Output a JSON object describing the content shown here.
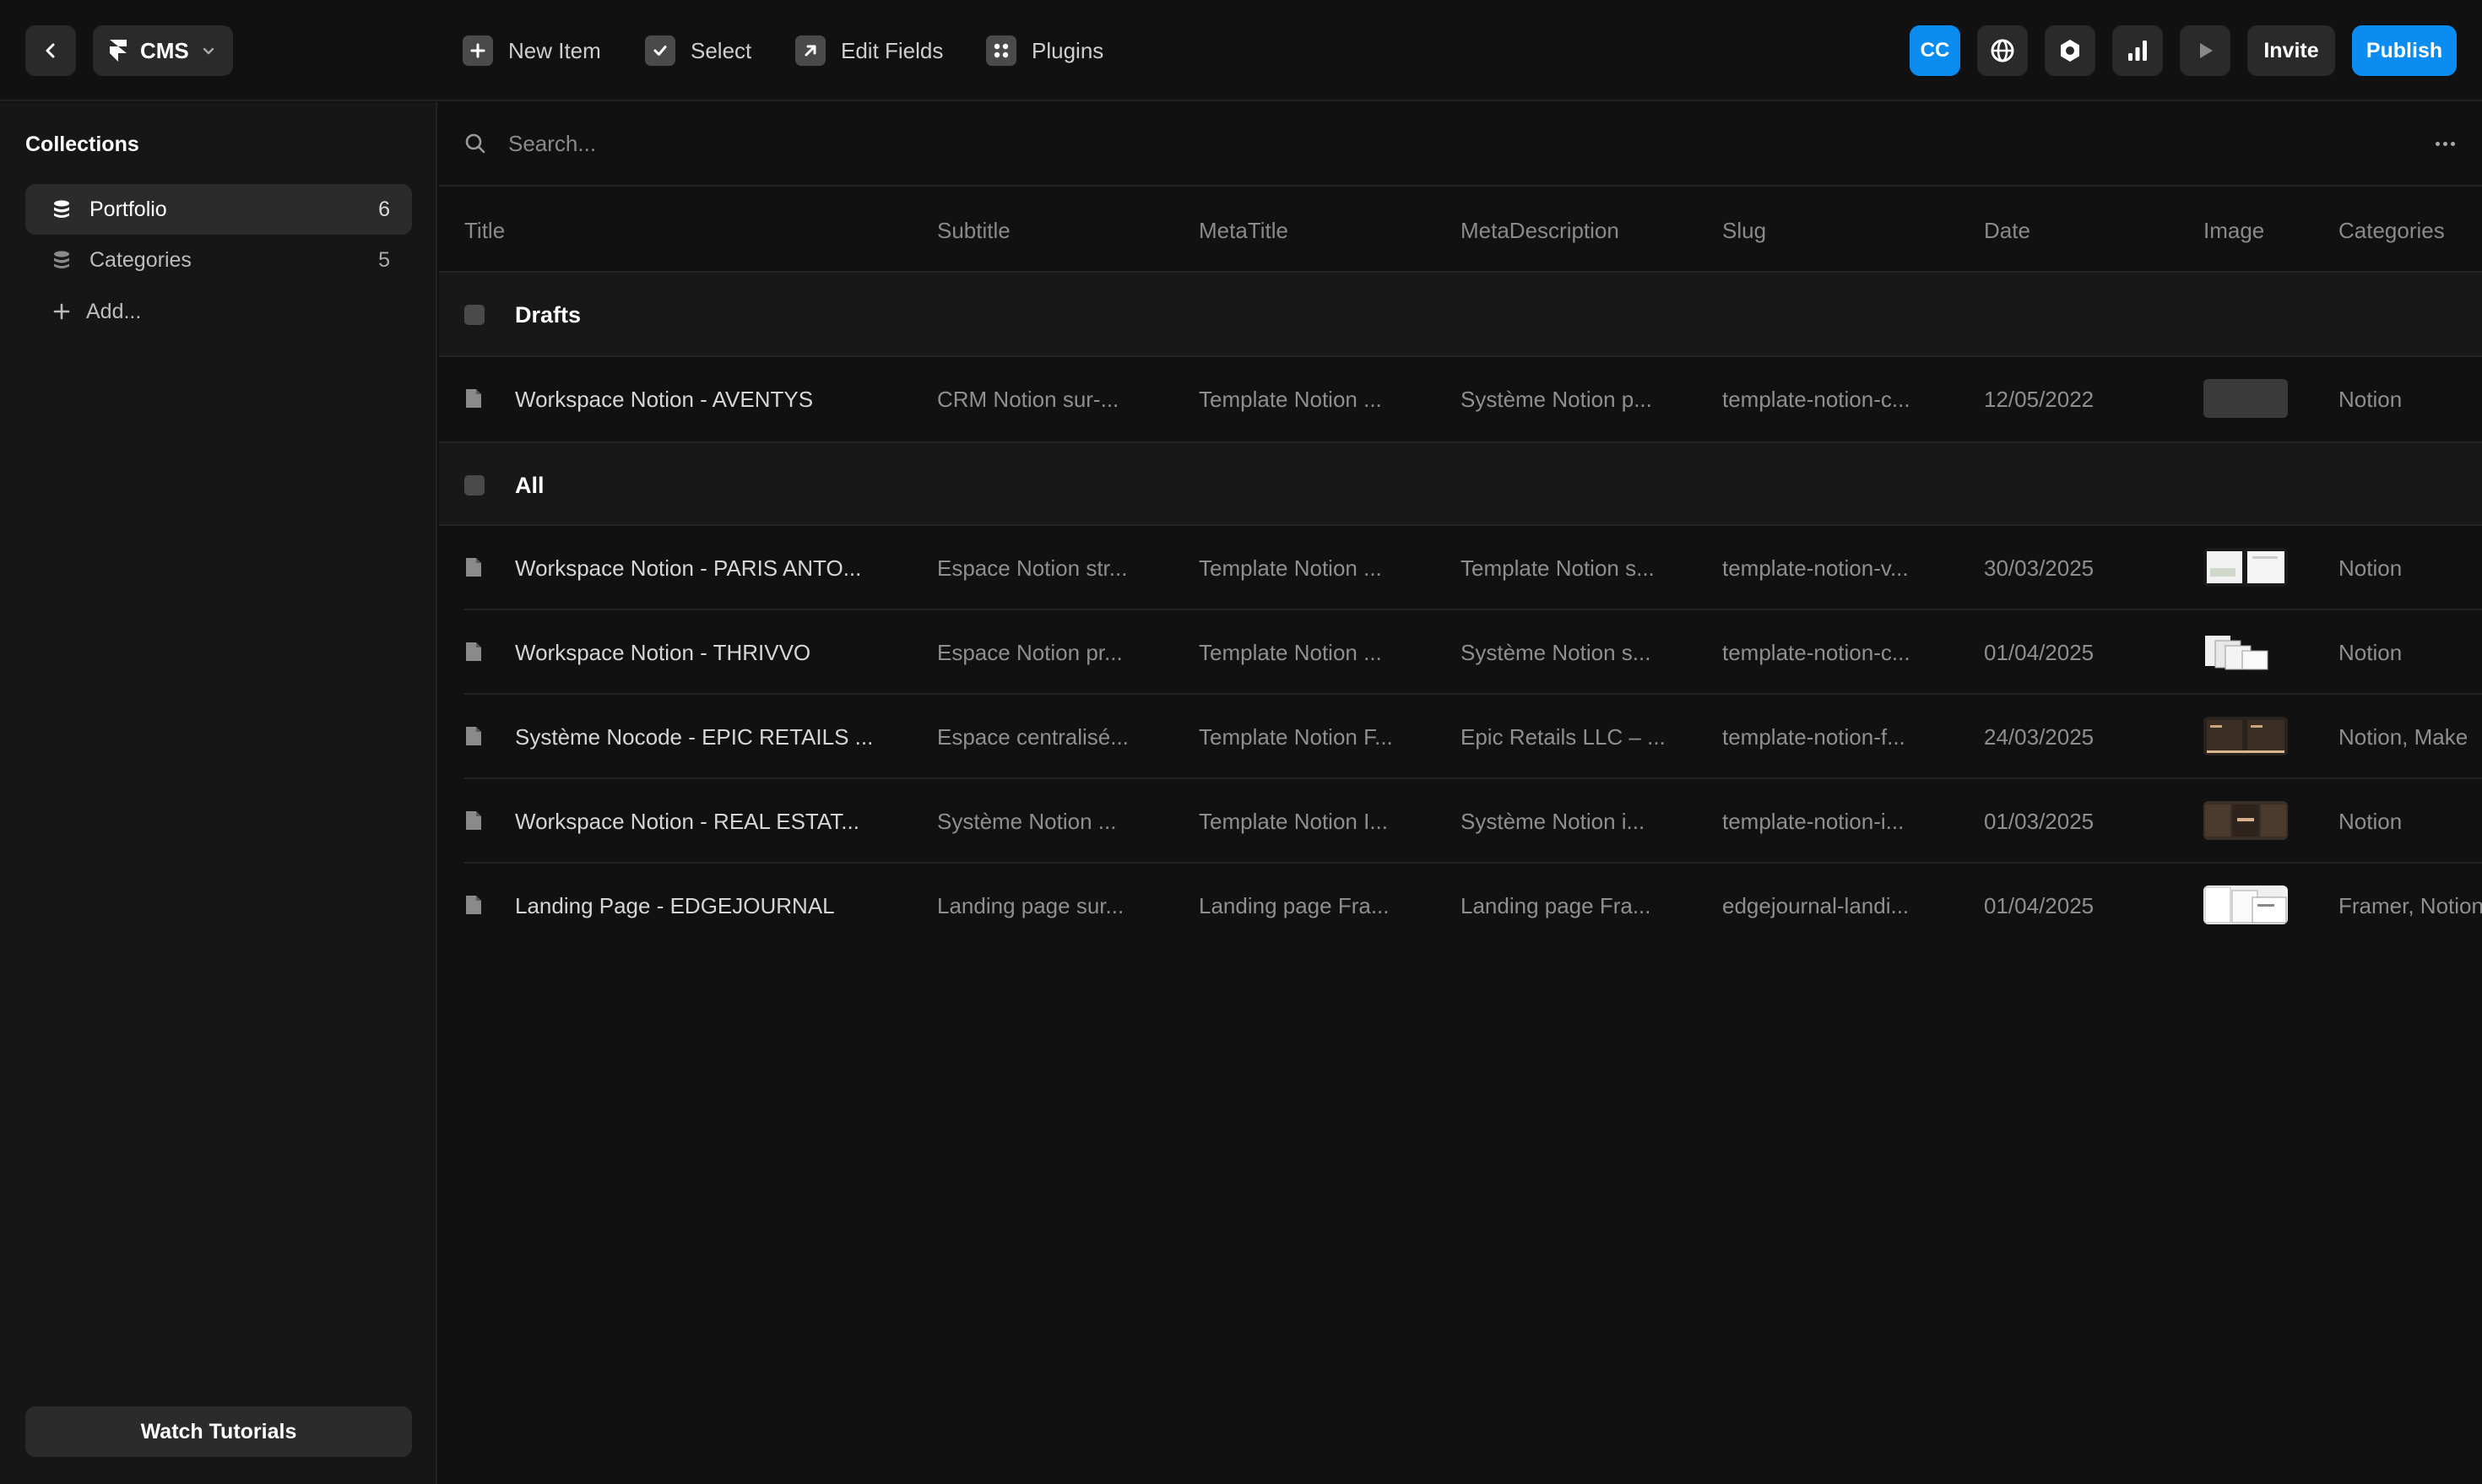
{
  "toolbar": {
    "cms_label": "CMS",
    "new_item": "New Item",
    "select": "Select",
    "edit_fields": "Edit Fields",
    "plugins": "Plugins",
    "avatar_initials": "CC",
    "invite": "Invite",
    "publish": "Publish",
    "accent_color": "#0a8cf0"
  },
  "sidebar": {
    "title": "Collections",
    "items": [
      {
        "label": "Portfolio",
        "count": "6",
        "icon": "database-icon"
      },
      {
        "label": "Categories",
        "count": "5",
        "icon": "database-icon"
      }
    ],
    "add_label": "Add...",
    "watch_tutorials": "Watch Tutorials"
  },
  "search": {
    "placeholder": "Search..."
  },
  "table": {
    "columns": [
      "Title",
      "Subtitle",
      "MetaTitle",
      "MetaDescription",
      "Slug",
      "Date",
      "Image",
      "Categories"
    ],
    "groups": [
      {
        "label": "Drafts",
        "rows": [
          {
            "title": "Workspace Notion - AVENTYS",
            "subtitle": "CRM Notion sur-...",
            "metatitle": "Template Notion ...",
            "metadescription": "Système Notion p...",
            "slug": "template-notion-c...",
            "date": "12/05/2022",
            "image": "empty",
            "categories": "Notion"
          }
        ]
      },
      {
        "label": "All",
        "rows": [
          {
            "title": "Workspace Notion - PARIS ANTO...",
            "subtitle": "Espace Notion str...",
            "metatitle": "Template Notion ...",
            "metadescription": "Template Notion s...",
            "slug": "template-notion-v...",
            "date": "30/03/2025",
            "image": "light",
            "categories": "Notion"
          },
          {
            "title": "Workspace Notion - THRIVVO",
            "subtitle": "Espace Notion pr...",
            "metatitle": "Template Notion ...",
            "metadescription": "Système Notion s...",
            "slug": "template-notion-c...",
            "date": "01/04/2025",
            "image": "light-stack",
            "categories": "Notion"
          },
          {
            "title": "Système Nocode - EPIC RETAILS ...",
            "subtitle": "Espace centralisé...",
            "metatitle": "Template Notion F...",
            "metadescription": "Epic Retails LLC – ...",
            "slug": "template-notion-f...",
            "date": "24/03/2025",
            "image": "dark",
            "categories": "Notion, Make"
          },
          {
            "title": "Workspace Notion - REAL ESTAT...",
            "subtitle": "Système Notion ...",
            "metatitle": "Template Notion I...",
            "metadescription": "Système Notion i...",
            "slug": "template-notion-i...",
            "date": "01/03/2025",
            "image": "dark",
            "categories": "Notion"
          },
          {
            "title": "Landing Page - EDGEJOURNAL",
            "subtitle": "Landing page sur...",
            "metatitle": "Landing page Fra...",
            "metadescription": "Landing page Fra...",
            "slug": "edgejournal-landi...",
            "date": "01/04/2025",
            "image": "light",
            "categories": "Framer, Notion"
          }
        ]
      }
    ]
  }
}
